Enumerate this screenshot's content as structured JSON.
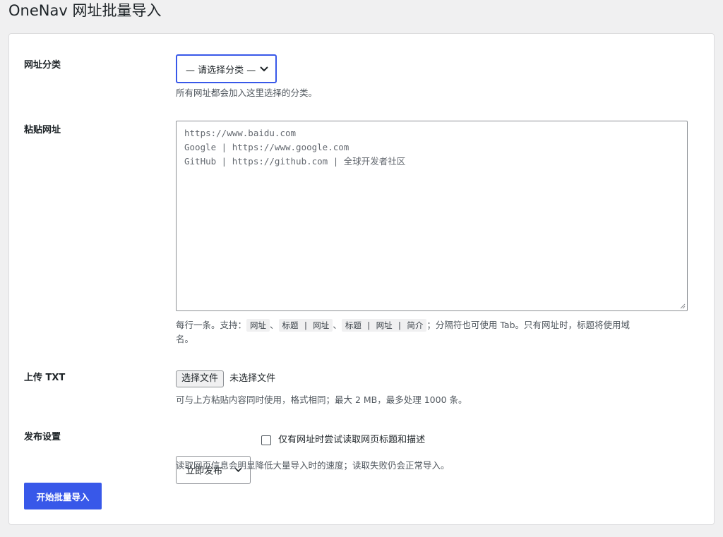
{
  "page": {
    "title": "OneNav 网址批量导入"
  },
  "category": {
    "label": "网址分类",
    "select_value": "— 请选择分类 —",
    "description": "所有网址都会加入这里选择的分类。"
  },
  "paste": {
    "label": "粘贴网址",
    "placeholder_lines": [
      "https://www.baidu.com",
      "Google | https://www.google.com",
      "GitHub | https://github.com | 全球开发者社区"
    ],
    "help": {
      "prefix": "每行一条。支持：",
      "code1": "网址",
      "sep1": "、",
      "code2": "标题 | 网址",
      "sep2": "、",
      "code3": "标题 | 网址 | 简介",
      "suffix1": "；分隔符也可使用 Tab。只有网址时，标题将使用域",
      "suffix2": "名。"
    }
  },
  "upload": {
    "label": "上传 TXT",
    "button": "选择文件",
    "status": "未选择文件",
    "description": "可与上方粘贴内容同时使用，格式相同；最大 2 MB，最多处理 1000 条。"
  },
  "publish": {
    "label": "发布设置",
    "select_value": "立即发布",
    "checkbox_label": "仅有网址时尝试读取网页标题和描述",
    "checkbox_checked": false,
    "description": "读取网页信息会明显降低大量导入时的速度；读取失败仍会正常导入。"
  },
  "submit": {
    "label": "开始批量导入"
  },
  "colors": {
    "accent": "#3858e9",
    "background": "#f0f0f1",
    "card": "#ffffff"
  },
  "icons": {
    "select_chevron": "chevron-down-icon",
    "resize_handle": "resize-handle-icon"
  }
}
